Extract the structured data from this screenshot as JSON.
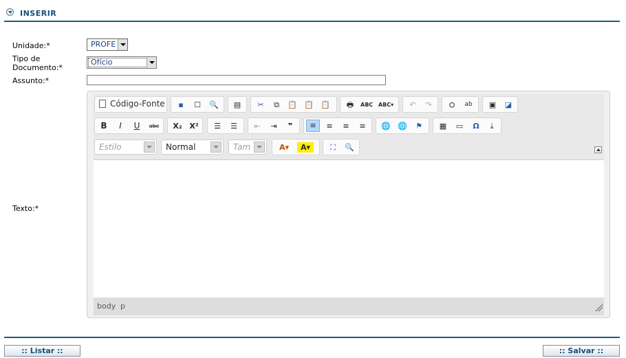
{
  "header": {
    "title": "INSERIR",
    "icon": "collapse-circle-icon"
  },
  "form": {
    "unidade_label": "Unidade:*",
    "unidade_value": "PROFE",
    "tipo_label_line1": "Tipo de",
    "tipo_label_line2": "Documento:*",
    "tipo_value": "Ofício",
    "assunto_label": "Assunto:*",
    "assunto_value": "",
    "texto_label": "Texto:*"
  },
  "editor": {
    "source_button": "Código-Fonte",
    "style_combo": "Estilo",
    "format_combo": "Normal",
    "size_combo": "Tam",
    "path": [
      "body",
      "p"
    ],
    "row2_buttons": [
      "B",
      "I",
      "U",
      "abc",
      "X₂",
      "X²"
    ]
  },
  "footer": {
    "list_button": ":: Listar ::",
    "save_button": ":: Salvar ::"
  },
  "colors": {
    "accent": "#1e5b7e",
    "title": "#15507a"
  }
}
